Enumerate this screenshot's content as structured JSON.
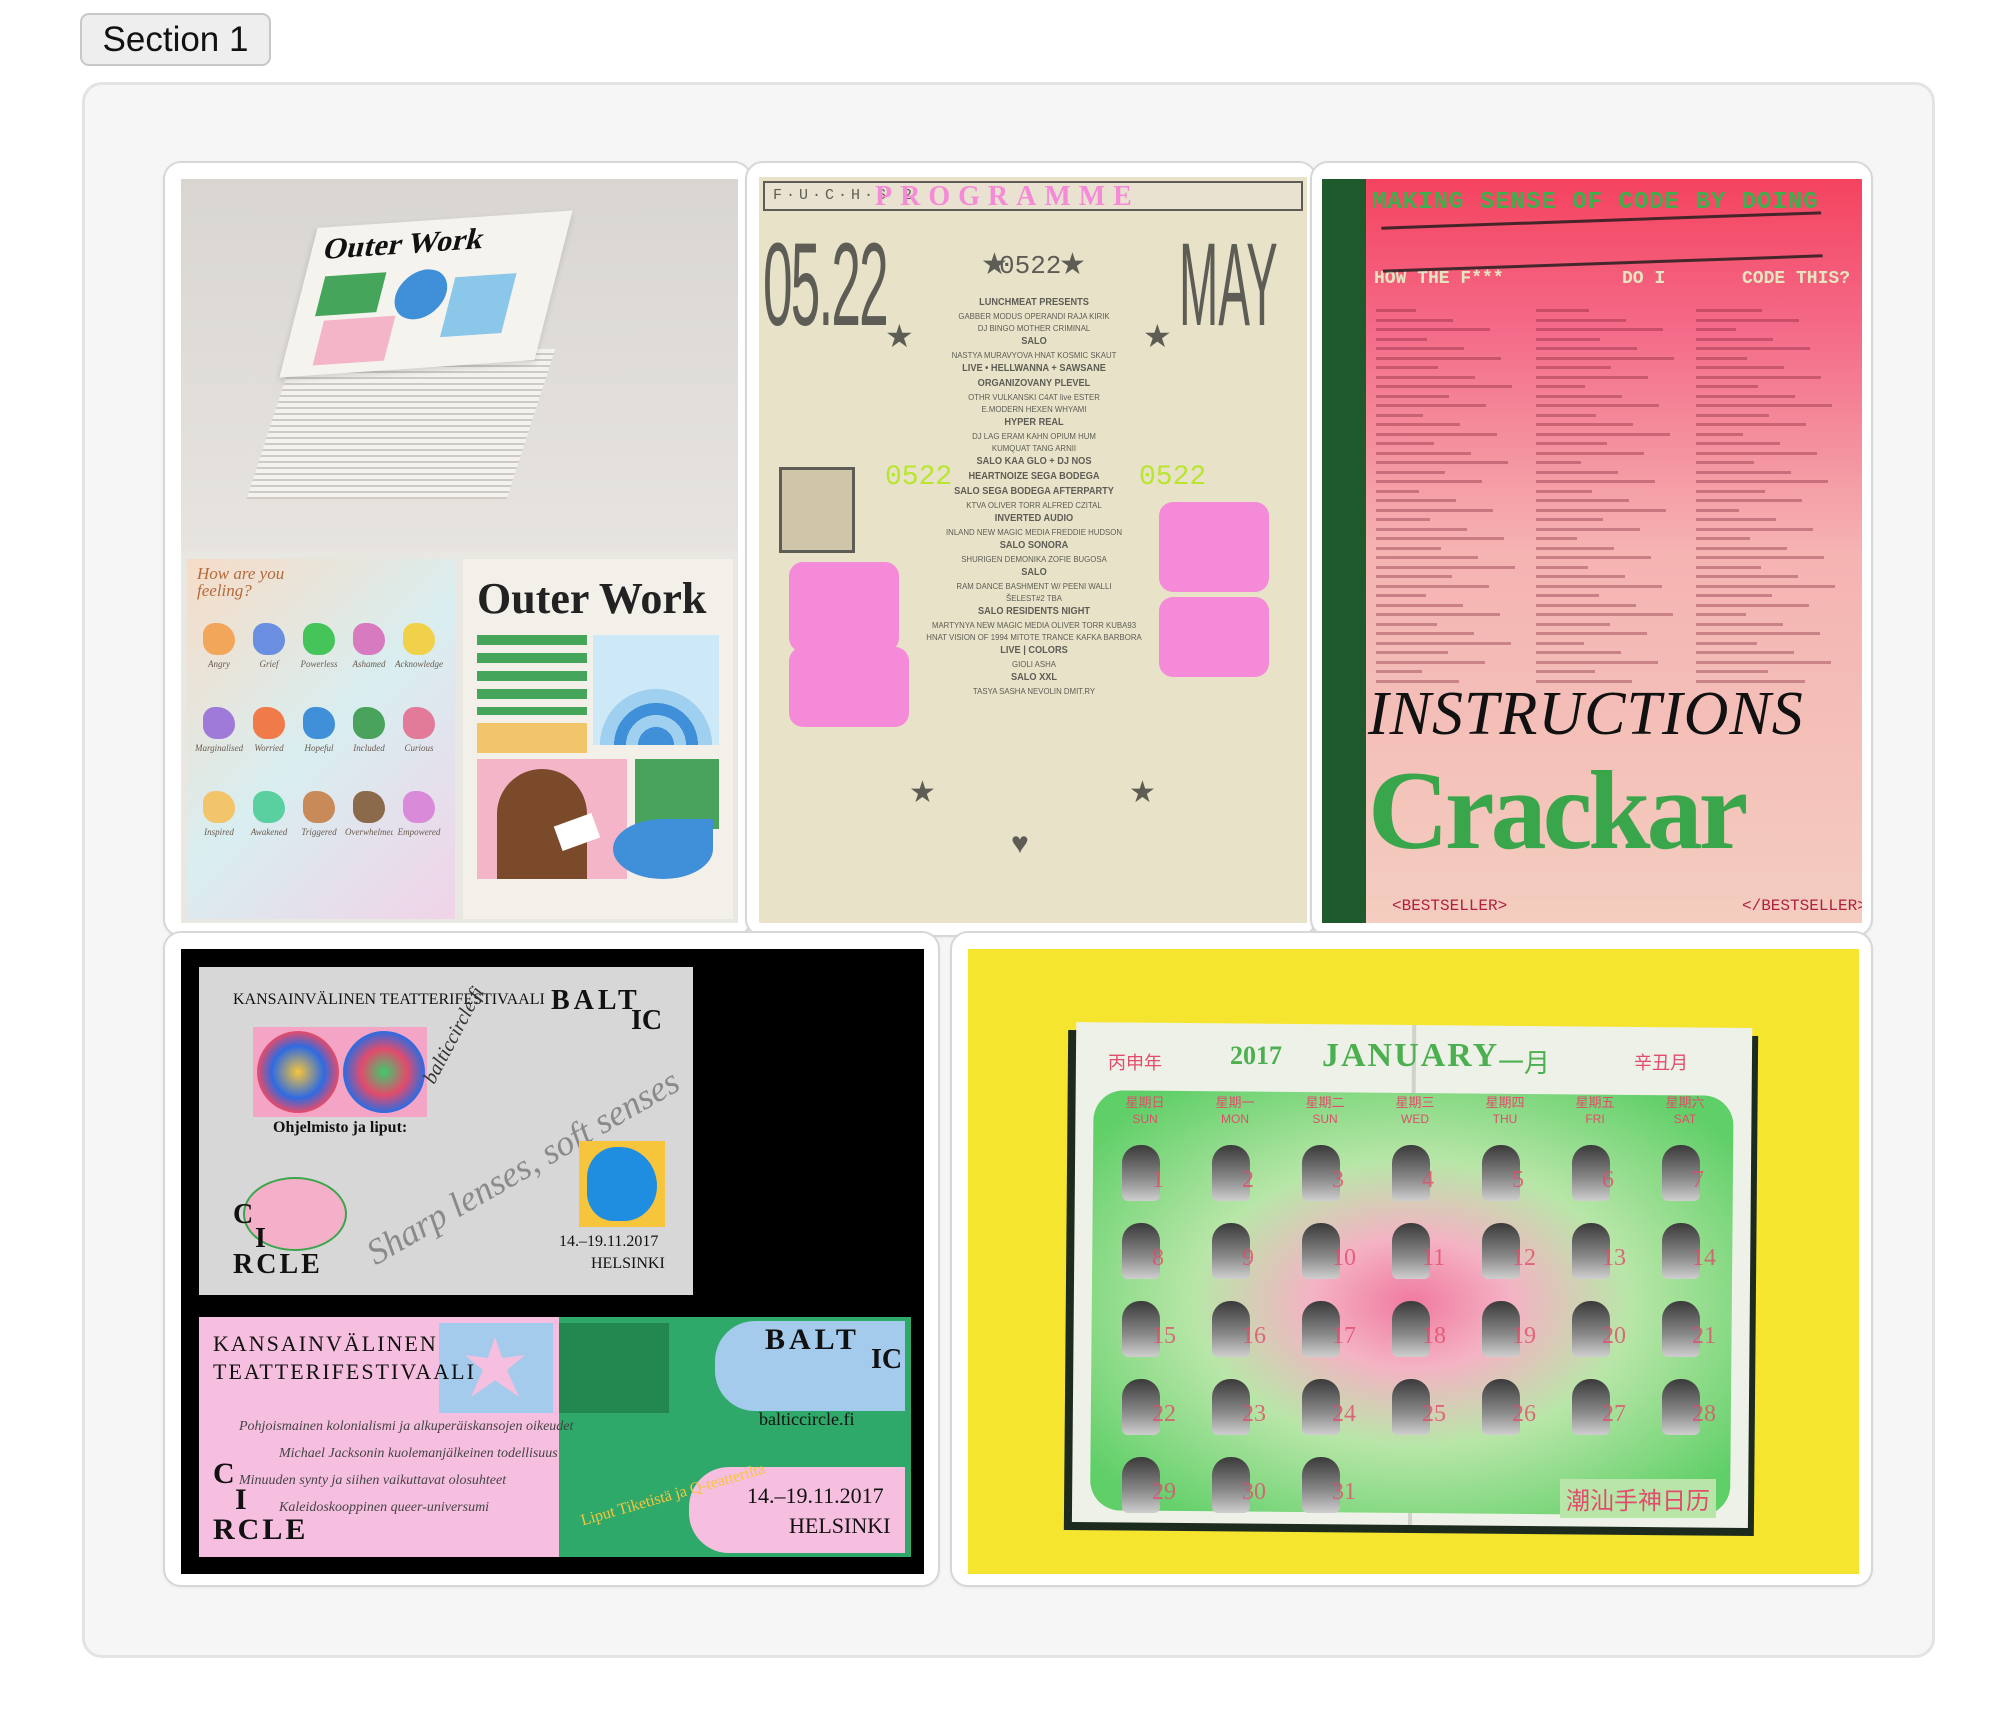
{
  "section": {
    "label": "Section 1"
  },
  "cards": {
    "outer_work": {
      "title_lines": [
        "Outer Work",
        "Outer Work"
      ],
      "question": "How are you feeling?",
      "emotions": [
        "Angry",
        "Grief",
        "Powerless",
        "Ashamed",
        "Acknowledged",
        "Marginalised",
        "Worried",
        "Hopeful",
        "Included",
        "Curious",
        "Inspired",
        "Awakened",
        "Triggered",
        "Overwhelmed",
        "Empowered"
      ],
      "colors": {
        "bg_top": "#dedad3",
        "pink": "#f4b5c9",
        "blue": "#3f8fd9",
        "green": "#45a55a"
      }
    },
    "programme": {
      "header": "F·U·C·H·S 2",
      "title": "PROGRAMME",
      "date_left": "05.22",
      "date_right": "MAY",
      "mini_date": "0522",
      "lineup": [
        "LUNCHMEAT PRESENTS",
        "GABBER MODUS OPERANDI  RAJA KIRIK",
        "DJ BINGO  MOTHER CRIMINAL",
        "SALO",
        "NASTYA MURAVYOVA  HNAT  KOSMIC SKAUT",
        "LIVE • HELLWANNA + SAWSANE",
        "ORGANIZOVANY PLEVEL",
        "OTHR  VULKANSKI  C4AT live  ESTER",
        "E.MODERN  HEXEN  WHYAMI",
        "HYPER REAL",
        "DJ LAG  ERAM  KAHN  OPIUM HUM",
        "KUMQUAT TANG  ARNII",
        "SALO  KAA GLO + DJ NOS",
        "HEARTNOIZE  SEGA BODEGA",
        "SALO  SEGA BODEGA AFTERPARTY",
        "KTVA  OLIVER TORR  ALFRED CZITAL",
        "INVERTED AUDIO",
        "INLAND  NEW MAGIC MEDIA  FREDDIE HUDSON",
        "SALO  SONORA",
        "SHURIGEN  DEMONIKA  ZOFIE BUGOSA",
        "SALO",
        "RAM DANCE BASHMENT W/ PEENI WALLI",
        "ŠELEST#2  TBA",
        "SALO RESIDENTS NIGHT",
        "MARTYNYA  NEW MAGIC MEDIA  OLIVER TORR  KUBA93",
        "HNAT  VISION OF 1994  MITOTE  TRANCE KAFKA  BARBORA",
        "LIVE | COLORS",
        "GIOLI ASHA",
        "SALO XXL",
        "TASYA  SASHA NEVOLIN  DMIT.RY"
      ],
      "colors": {
        "paper": "#e7e2c8",
        "ink": "#5e5d55",
        "pink": "#f58ad8",
        "lime": "#c9ff4d"
      }
    },
    "code_poster": {
      "headline": "MAKING SENSE OF CODE BY DOING",
      "subline": [
        "HOW THE F***",
        "DO I",
        "CODE THIS?"
      ],
      "title": "INSTRUCTIONS",
      "graffiti": "Crackar",
      "tag_left": "<BESTSELLER>",
      "tag_right": "</BESTSELLER>",
      "colors": {
        "pink": "#f35b7b",
        "green": "#2e9a42",
        "spine": "#1f5a2c"
      }
    },
    "baltic_circle": {
      "top_card": {
        "header": "KANSAINVÄLINEN TEATTERIFESTIVAALI",
        "logo_top": [
          "BALT",
          "IC"
        ],
        "logo_bottom": [
          "C",
          "I",
          "RCLE"
        ],
        "site": "balticcircle.fi",
        "label": "Ohjelmisto ja liput:",
        "script": "Sharp lenses, soft senses",
        "dates": "14.–19.11.2017",
        "city": "HELSINKI"
      },
      "bottom_card": {
        "header_lines": [
          "KANSAINVÄLINEN",
          "TEATTERIFESTIVAALI"
        ],
        "logo_top": [
          "BALT",
          "IC"
        ],
        "logo_bottom": [
          "C",
          "I",
          "RCLE"
        ],
        "program": [
          "Pohjoismainen kolonialismi ja alkuperäiskansojen oikeudet",
          "Michael Jacksonin kuolemanjälkeinen todellisuus",
          "Minuuden synty ja siihen vaikuttavat olosuhteet",
          "Kaleidoskooppinen queer-universumi"
        ],
        "site": "balticcircle.fi",
        "tickets": "Liput Tiketistä ja Q-teatterilta",
        "dates": "14.–19.11.2017",
        "city": "HELSINKI"
      },
      "colors": {
        "grey": "#d7d7d7",
        "pink": "#f6bfe0",
        "green": "#2fa96a",
        "blue": "#a4cbec"
      }
    },
    "calendar": {
      "year": "2017",
      "month": "JANUARY",
      "month_cn": "一月",
      "left_corner": "丙申年",
      "right_corner": "辛丑月",
      "weekdays": [
        {
          "cn": "星期日",
          "en": "SUN"
        },
        {
          "cn": "星期一",
          "en": "MON"
        },
        {
          "cn": "星期二",
          "en": "SUN"
        },
        {
          "cn": "星期三",
          "en": "WED"
        },
        {
          "cn": "星期四",
          "en": "THU"
        },
        {
          "cn": "星期五",
          "en": "FRI"
        },
        {
          "cn": "星期六",
          "en": "SAT"
        }
      ],
      "days": [
        "1",
        "2",
        "3",
        "4",
        "5",
        "6",
        "7",
        "8",
        "9",
        "10",
        "11",
        "12",
        "13",
        "14",
        "15",
        "16",
        "17",
        "18",
        "19",
        "20",
        "21",
        "22",
        "23",
        "24",
        "25",
        "26",
        "27",
        "28",
        "29",
        "30",
        "31"
      ],
      "footer": "潮汕手神日历",
      "colors": {
        "bg": "#f5e52e",
        "green": "#5fcf67",
        "pink": "#f07aa0",
        "page": "#eef1e8"
      }
    }
  }
}
